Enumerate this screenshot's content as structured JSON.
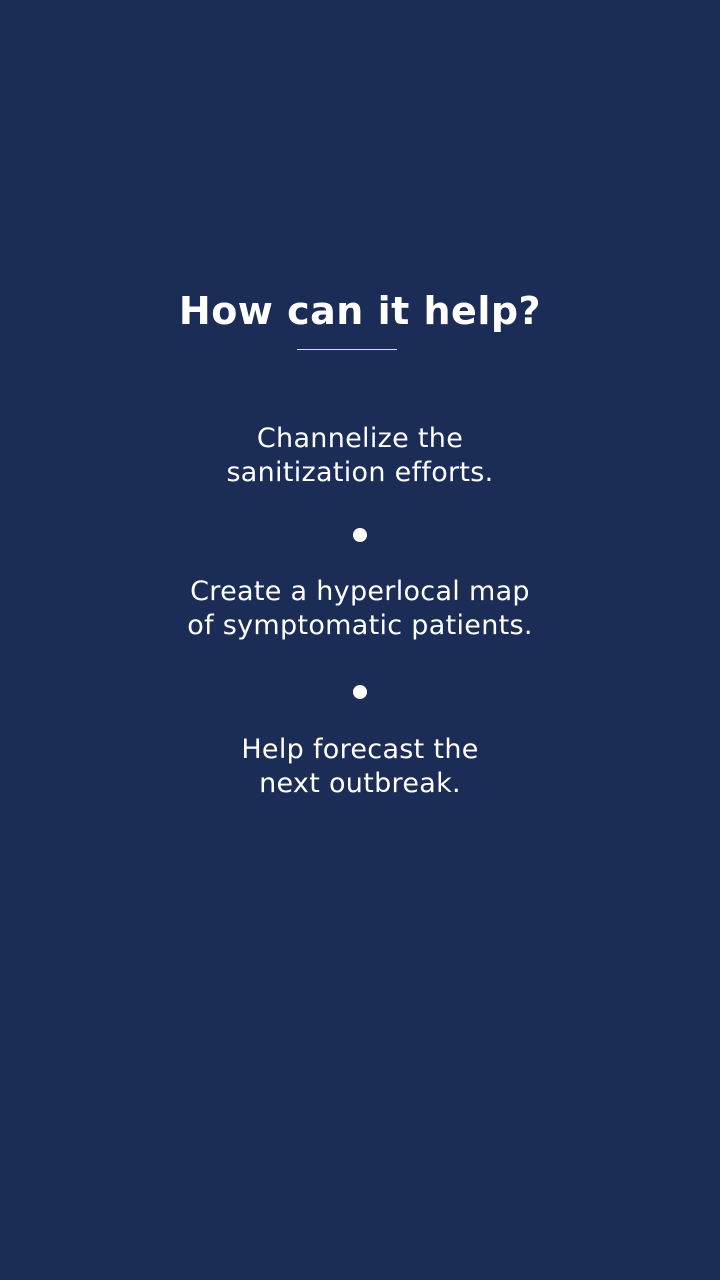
{
  "screen": {
    "title": "How can it help?",
    "points": [
      {
        "line1": "Channelize the",
        "line2": "sanitization efforts."
      },
      {
        "line1": "Create a hyperlocal map",
        "line2": "of symptomatic patients."
      },
      {
        "line1": "Help forecast the",
        "line2": "next outbreak."
      }
    ]
  },
  "colors": {
    "background": "#1b2d56",
    "text": "#ffffff"
  }
}
